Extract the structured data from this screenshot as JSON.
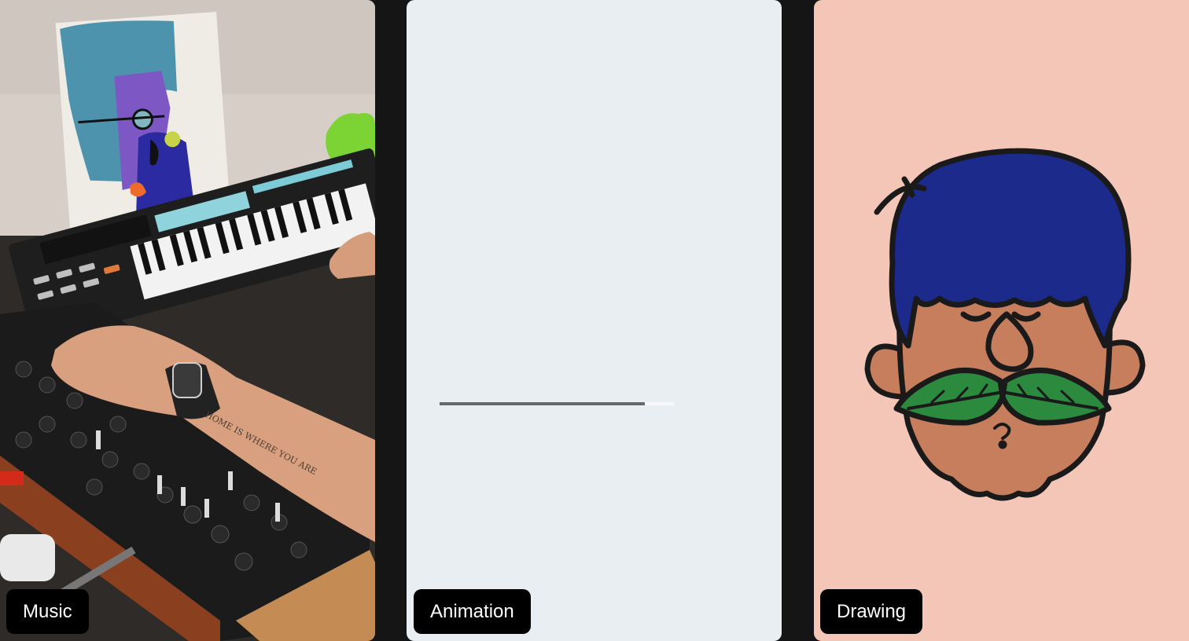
{
  "panels": [
    {
      "label": "Music",
      "image": "music-photo",
      "accent": "#000000"
    },
    {
      "label": "Animation",
      "image": "animation-frame",
      "accent": "#000000"
    },
    {
      "label": "Drawing",
      "image": "drawing-illustration",
      "accent": "#000000"
    }
  ],
  "animation": {
    "progress": 0.876
  },
  "colors": {
    "page_background": "#151515",
    "animation_background": "#e8eef1",
    "drawing_background": "#f4c6b8",
    "label_background": "#000000",
    "label_text": "#ffffff"
  }
}
